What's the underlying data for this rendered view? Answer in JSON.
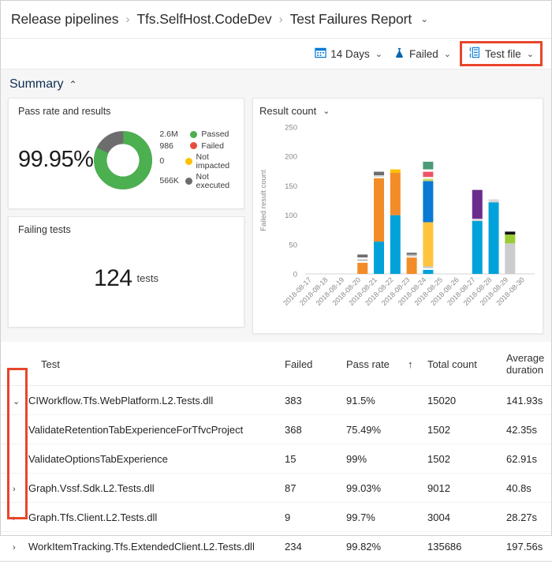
{
  "breadcrumb": {
    "items": [
      "Release pipelines",
      "Tfs.SelfHost.CodeDev",
      "Test Failures Report"
    ],
    "separator": "›",
    "caret": "⌄"
  },
  "toolbar": {
    "date_filter": {
      "label": "14 Days",
      "icon": "calendar-icon",
      "caret": "⌄"
    },
    "outcome_filter": {
      "label": "Failed",
      "icon": "flask-icon",
      "caret": "⌄"
    },
    "group_filter": {
      "label": "Test file",
      "icon": "group-list-icon",
      "caret": "⌄"
    },
    "highlight_color": "#e8452c"
  },
  "summary": {
    "title": "Summary",
    "chevron": "⌃",
    "pass_rate_card": {
      "title": "Pass rate and results",
      "percent": "99.95%",
      "legend": [
        {
          "value": "2.6M",
          "label": "Passed",
          "color": "#4caf50"
        },
        {
          "value": "986",
          "label": "Failed",
          "color": "#e74c3c"
        },
        {
          "value": "0",
          "label": "Not impacted",
          "color": "#ffc107"
        },
        {
          "value": "566K",
          "label": "Not executed",
          "color": "#6d6d6d"
        }
      ],
      "donut": {
        "passed_pct": 82,
        "not_executed_pct": 18
      }
    },
    "failing_card": {
      "title": "Failing tests",
      "count": "124",
      "unit": "tests"
    }
  },
  "chart_data": {
    "type": "bar",
    "stacked": true,
    "title": "Result count",
    "caret": "⌄",
    "xlabel": "",
    "ylabel": "Failed result count",
    "ylim": [
      0,
      250
    ],
    "yticks": [
      0,
      50,
      100,
      150,
      200,
      250
    ],
    "grid": false,
    "legend": "none",
    "categories": [
      "2018-08-17",
      "2018-08-18",
      "2018-08-19",
      "2018-08-20",
      "2018-08-21",
      "2018-08-22",
      "2018-08-23",
      "2018-08-24",
      "2018-08-25",
      "2018-08-26",
      "2018-08-27",
      "2018-08-28",
      "2018-08-29",
      "2018-08-30"
    ],
    "totals": [
      0,
      0,
      0,
      33,
      174,
      178,
      36,
      191,
      0,
      0,
      143,
      127,
      72,
      0
    ],
    "bars": [
      {
        "category": "2018-08-17",
        "segments": []
      },
      {
        "category": "2018-08-18",
        "segments": []
      },
      {
        "category": "2018-08-19",
        "segments": []
      },
      {
        "category": "2018-08-20",
        "segments": [
          {
            "color": "#f28c28",
            "value": 19
          },
          {
            "color": "#ffffff",
            "value": 3
          },
          {
            "color": "#bdbdbd",
            "value": 3
          },
          {
            "color": "#ffffff",
            "value": 3
          },
          {
            "color": "#6d6d6d",
            "value": 5
          }
        ]
      },
      {
        "category": "2018-08-21",
        "segments": [
          {
            "color": "#00a2d9",
            "value": 55
          },
          {
            "color": "#f28c28",
            "value": 108
          },
          {
            "color": "#ffffff",
            "value": 2
          },
          {
            "color": "#d8d8d8",
            "value": 3
          },
          {
            "color": "#6d6d6d",
            "value": 6
          }
        ]
      },
      {
        "category": "2018-08-22",
        "segments": [
          {
            "color": "#00a2d9",
            "value": 100
          },
          {
            "color": "#f28c28",
            "value": 72
          },
          {
            "color": "#ffc107",
            "value": 6
          }
        ]
      },
      {
        "category": "2018-08-23",
        "segments": [
          {
            "color": "#f28c28",
            "value": 28
          },
          {
            "color": "#ffffff",
            "value": 2
          },
          {
            "color": "#bdbdbd",
            "value": 3
          },
          {
            "color": "#6d6d6d",
            "value": 3
          }
        ]
      },
      {
        "category": "2018-08-24",
        "segments": [
          {
            "color": "#00a2d9",
            "value": 7
          },
          {
            "color": "#ffffff",
            "value": 3
          },
          {
            "color": "#c8c8c8",
            "value": 3
          },
          {
            "color": "#ffc43d",
            "value": 75
          },
          {
            "color": "#0a7ad4",
            "value": 70
          },
          {
            "color": "#c9d96a",
            "value": 4
          },
          {
            "color": "#ffffff",
            "value": 3
          },
          {
            "color": "#ef5366",
            "value": 9
          },
          {
            "color": "#ffffff",
            "value": 4
          },
          {
            "color": "#4b9a78",
            "value": 13
          }
        ]
      },
      {
        "category": "2018-08-25",
        "segments": []
      },
      {
        "category": "2018-08-26",
        "segments": []
      },
      {
        "category": "2018-08-27",
        "segments": [
          {
            "color": "#00a2d9",
            "value": 90
          },
          {
            "color": "#d8d8d8",
            "value": 4
          },
          {
            "color": "#6a2d8e",
            "value": 49
          }
        ]
      },
      {
        "category": "2018-08-28",
        "segments": [
          {
            "color": "#00a2d9",
            "value": 122
          },
          {
            "color": "#d8d8d8",
            "value": 5
          }
        ]
      },
      {
        "category": "2018-08-29",
        "segments": [
          {
            "color": "#cccccc",
            "value": 52
          },
          {
            "color": "#9acd32",
            "value": 15
          },
          {
            "color": "#111111",
            "value": 5
          }
        ]
      },
      {
        "category": "2018-08-30",
        "segments": []
      }
    ]
  },
  "table": {
    "columns": [
      "Test",
      "Failed",
      "Pass rate",
      "Total count",
      "Average duration"
    ],
    "sort_indicator": "↑",
    "rows": [
      {
        "expand": "⌄",
        "level": 0,
        "name": "CIWorkflow.Tfs.WebPlatform.L2.Tests.dll",
        "failed": "383",
        "pass_rate": "91.5%",
        "total": "15020",
        "duration": "141.93s"
      },
      {
        "expand": "",
        "level": 1,
        "name": "ValidateRetentionTabExperienceForTfvcProject",
        "failed": "368",
        "pass_rate": "75.49%",
        "total": "1502",
        "duration": "42.35s"
      },
      {
        "expand": "",
        "level": 1,
        "name": "ValidateOptionsTabExperience",
        "failed": "15",
        "pass_rate": "99%",
        "total": "1502",
        "duration": "62.91s"
      },
      {
        "expand": "›",
        "level": 0,
        "name": "Graph.Vssf.Sdk.L2.Tests.dll",
        "failed": "87",
        "pass_rate": "99.03%",
        "total": "9012",
        "duration": "40.8s"
      },
      {
        "expand": "›",
        "level": 0,
        "name": "Graph.Tfs.Client.L2.Tests.dll",
        "failed": "9",
        "pass_rate": "99.7%",
        "total": "3004",
        "duration": "28.27s"
      },
      {
        "expand": "›",
        "level": 0,
        "name": "WorkItemTracking.Tfs.ExtendedClient.L2.Tests.dll",
        "failed": "234",
        "pass_rate": "99.82%",
        "total": "135686",
        "duration": "197.56s"
      }
    ]
  }
}
